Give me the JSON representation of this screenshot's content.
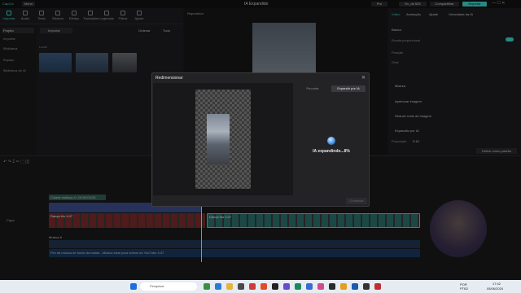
{
  "app": {
    "logo": "CapCut",
    "menu_label": "Menu",
    "title": "IA Expandido"
  },
  "top_buttons": [
    {
      "label": "Pro"
    },
    {
      "label": "Ex_ott 525"
    },
    {
      "label": "Compartilhar"
    },
    {
      "label": "Exportar"
    }
  ],
  "toolbar": {
    "items": [
      "Importar",
      "Áudio",
      "Texto",
      "Stickers",
      "Efeitos",
      "Transições",
      "Legendas",
      "Filtros",
      "Ajuste"
    ]
  },
  "leftnav": {
    "items": [
      "Projeto",
      "Importar",
      "Biblioteca",
      "Espaço",
      "Biblioteca de IA"
    ]
  },
  "media": {
    "import_label": "Importar",
    "sort_label": "Ordenar",
    "all_label": "Tudo",
    "section_label": "Local"
  },
  "player": {
    "label": "Reprodutor"
  },
  "right_panel": {
    "tabs": [
      "Vídeo",
      "Animação",
      "Ajuste",
      "Velocidade da IA"
    ],
    "section_basic": "Básico",
    "fields": [
      "Escala proporcional",
      "Posição",
      "Girar"
    ],
    "options": [
      "Mistura",
      "Aprimorar imagem",
      "Reduzir ruído de imagem",
      "Expansão por IA"
    ],
    "proportion_label": "Proporção",
    "proportion_value": "9:16",
    "action_label": "Definir como padrão"
  },
  "dialog": {
    "title": "Redimensionar",
    "tabs": [
      "Recortar",
      "Expandir por IA"
    ],
    "status": "IA expandindo...8%",
    "continue_label": "Continuar"
  },
  "timeline": {
    "cover_label": "Capa",
    "clip_text_label": "Cidade estilosa 4 • 00:00:04:03",
    "clip_video_label": "Dança trio 4:47",
    "clip_video2_label": "Dança trio 4:47",
    "audio_label": "Fim da música de fundo da batida - Música ideal para vídeos do YouTube 4:47",
    "audio2_label": "Música 6"
  },
  "taskbar": {
    "search_placeholder": "Pesquisar",
    "lang": "POR\nPTB2",
    "time": "17:42",
    "date": "05/06/2024"
  },
  "colors": {
    "accent": "#3cd3c8",
    "dialog_bg": "#232326",
    "expand_tab": "#3a3a3e"
  }
}
